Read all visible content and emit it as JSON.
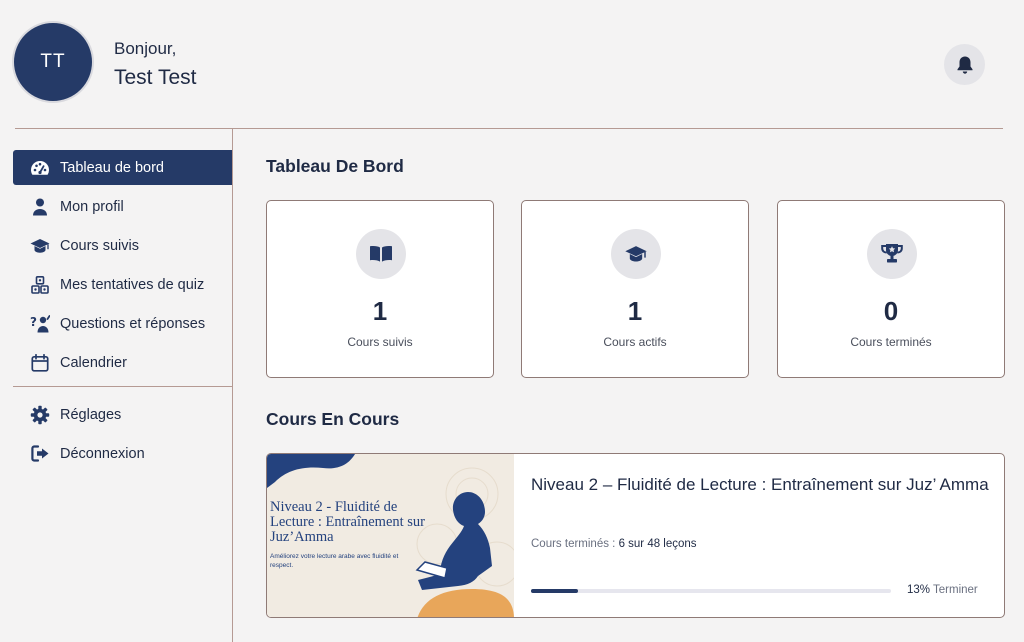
{
  "header": {
    "avatar_initials": "TT",
    "greeting": "Bonjour,",
    "user_name": "Test Test",
    "notification_icon": "bell-icon"
  },
  "sidebar": {
    "items": [
      {
        "label": "Tableau de bord",
        "icon": "dashboard-icon",
        "active": true
      },
      {
        "label": "Mon profil",
        "icon": "user-icon"
      },
      {
        "label": "Cours suivis",
        "icon": "graduation-cap-icon"
      },
      {
        "label": "Mes tentatives de quiz",
        "icon": "cubes-icon"
      },
      {
        "label": "Questions et réponses",
        "icon": "question-person-icon"
      },
      {
        "label": "Calendrier",
        "icon": "calendar-icon"
      }
    ],
    "bottom_items": [
      {
        "label": "Réglages",
        "icon": "gear-icon"
      },
      {
        "label": "Déconnexion",
        "icon": "logout-icon"
      }
    ]
  },
  "dashboard": {
    "title": "Tableau De Bord",
    "stats": [
      {
        "value": "1",
        "label": "Cours suivis",
        "icon": "book-icon"
      },
      {
        "value": "1",
        "label": "Cours actifs",
        "icon": "graduation-cap-icon"
      },
      {
        "value": "0",
        "label": "Cours terminés",
        "icon": "trophy-icon"
      }
    ]
  },
  "in_progress": {
    "title": "Cours En Cours",
    "course": {
      "thumb_title": "Niveau 2 - Fluidité de Lecture : Entraînement sur Juz’Amma",
      "thumb_subtitle": "Améliorez votre lecture arabe avec fluidité et respect.",
      "title": "Niveau 2 – Fluidité de Lecture : Entraînement sur Juz’ Amma",
      "meta_label": "Cours terminés :",
      "meta_value": "6 sur 48 leçons",
      "progress_percent": 13,
      "progress_text": "13%",
      "progress_label": "Terminer"
    }
  },
  "colors": {
    "primary": "#253a67",
    "divider": "#b59a93",
    "background": "#f4f3f3",
    "accent_orange": "#e8a65a"
  }
}
